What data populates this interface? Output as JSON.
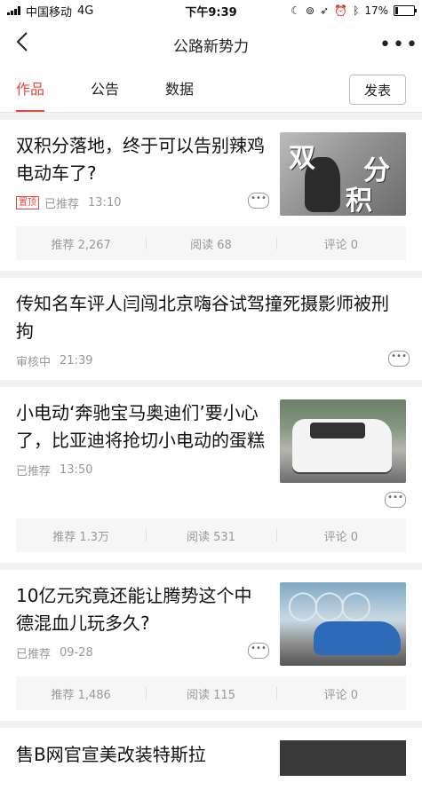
{
  "status_bar": {
    "carrier": "中国移动",
    "network": "4G",
    "time": "下午9:39",
    "battery": "17%",
    "battery_level": 0.17
  },
  "nav": {
    "title": "公路新势力",
    "back_icon": "chevron-left-icon",
    "more_icon": "more-dots-icon"
  },
  "tabs": [
    {
      "label": "作品",
      "active": true
    },
    {
      "label": "公告",
      "active": false
    },
    {
      "label": "数据",
      "active": false
    }
  ],
  "publish_label": "发表",
  "accent_color": "#e8463d",
  "articles": [
    {
      "title": "双积分落地，终于可以告别辣鸡电动车了?",
      "tag": "置顶",
      "status": "已推荐",
      "time": "13:10",
      "thumb_text_1": "双",
      "thumb_text_2": "分",
      "thumb_text_3": "积",
      "stats": {
        "recommend": "推荐 2,267",
        "read": "阅读 68",
        "comment": "评论 0"
      }
    },
    {
      "title": "传知名车评人闫闯北京嗨谷试驾撞死摄影师被刑拘",
      "status": "审核中",
      "time": "21:39"
    },
    {
      "title": "小电动‘奔驰宝马奥迪们’要小心了，比亚迪将抢切小电动的蛋糕",
      "status": "已推荐",
      "time": "13:50",
      "stats": {
        "recommend": "推荐 1.3万",
        "read": "阅读 531",
        "comment": "评论 0"
      }
    },
    {
      "title": "10亿元究竟还能让腾势这个中德混血儿玩多久?",
      "status": "已推荐",
      "time": "09-28",
      "stats": {
        "recommend": "推荐 1,486",
        "read": "阅读 115",
        "comment": "评论 0"
      }
    },
    {
      "title": "售B网官宣美改装特斯拉"
    }
  ],
  "more_label": "•••"
}
